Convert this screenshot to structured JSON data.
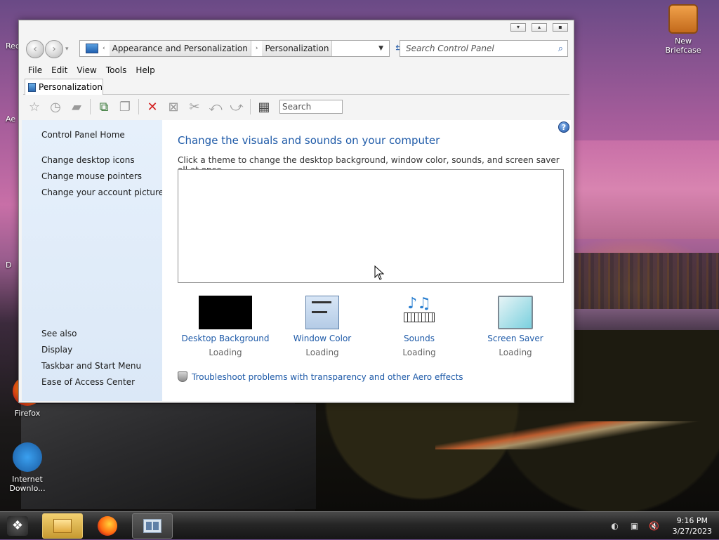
{
  "desktop": {
    "icons": [
      {
        "label": "New Briefcase",
        "icon": "briefcase-icon"
      },
      {
        "label": "Firefox",
        "icon": "firefox-icon"
      },
      {
        "label": "Internet Downlo...",
        "icon": "internet-download-manager-icon"
      }
    ],
    "left_partial_labels": [
      "Rec",
      "Ae",
      "D"
    ]
  },
  "window": {
    "controls": [
      "minimize",
      "maximize",
      "close"
    ],
    "address": {
      "segments": [
        "Appearance and Personalization",
        "Personalization"
      ]
    },
    "search_placeholder": "Search Control Panel",
    "menu": [
      "File",
      "Edit",
      "View",
      "Tools",
      "Help"
    ],
    "tab_label": "Personalization",
    "toolbar_search": "Search",
    "sidebar": {
      "home": "Control Panel Home",
      "links": [
        "Change desktop icons",
        "Change mouse pointers",
        "Change your account picture"
      ],
      "see_also_title": "See also",
      "see_also": [
        "Display",
        "Taskbar and Start Menu",
        "Ease of Access Center"
      ]
    },
    "content": {
      "title": "Change the visuals and sounds on your computer",
      "description": "Click a theme to change the desktop background, window color, sounds, and screen saver all at once.",
      "options": [
        {
          "label": "Desktop Background",
          "status": "Loading"
        },
        {
          "label": "Window Color",
          "status": "Loading"
        },
        {
          "label": "Sounds",
          "status": "Loading"
        },
        {
          "label": "Screen Saver",
          "status": "Loading"
        }
      ],
      "troubleshoot": "Troubleshoot problems with transparency and other Aero effects"
    }
  },
  "taskbar": {
    "time": "9:16 PM",
    "date": "3/27/2023"
  },
  "colors": {
    "link_blue": "#1e5aa8",
    "sidebar_bg": "#e6f0fb",
    "taskbar": "#262626"
  }
}
